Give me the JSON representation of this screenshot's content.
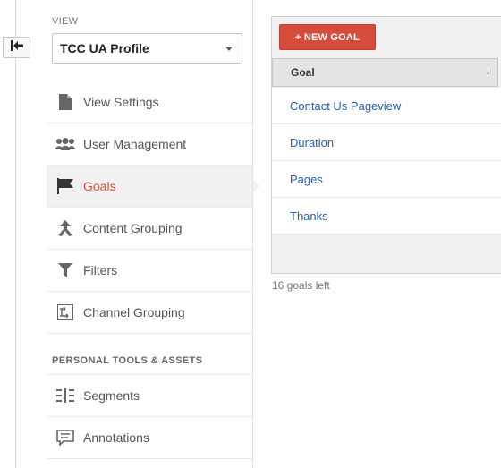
{
  "nav_back_icon": "arrow-left-icon",
  "view": {
    "label": "VIEW",
    "selected": "TCC UA Profile"
  },
  "sidebar": {
    "items": [
      {
        "label": "View Settings",
        "icon": "document-icon"
      },
      {
        "label": "User Management",
        "icon": "users-icon"
      },
      {
        "label": "Goals",
        "icon": "flag-icon",
        "active": true
      },
      {
        "label": "Content Grouping",
        "icon": "content-grouping-icon"
      },
      {
        "label": "Filters",
        "icon": "filter-icon"
      },
      {
        "label": "Channel Grouping",
        "icon": "channel-grouping-icon"
      }
    ],
    "section_label": "PERSONAL TOOLS & ASSETS",
    "tools": [
      {
        "label": "Segments",
        "icon": "segments-icon"
      },
      {
        "label": "Annotations",
        "icon": "annotation-icon"
      }
    ]
  },
  "goals": {
    "new_button": "+ NEW GOAL",
    "column_header": "Goal",
    "sort_icon": "sort-down-icon",
    "rows": [
      "Contact Us Pageview",
      "Duration",
      "Pages",
      "Thanks"
    ],
    "remaining": "16 goals left"
  },
  "colors": {
    "accent": "#dd4b39",
    "button": "#d64c3b",
    "link": "#2a5db0"
  }
}
